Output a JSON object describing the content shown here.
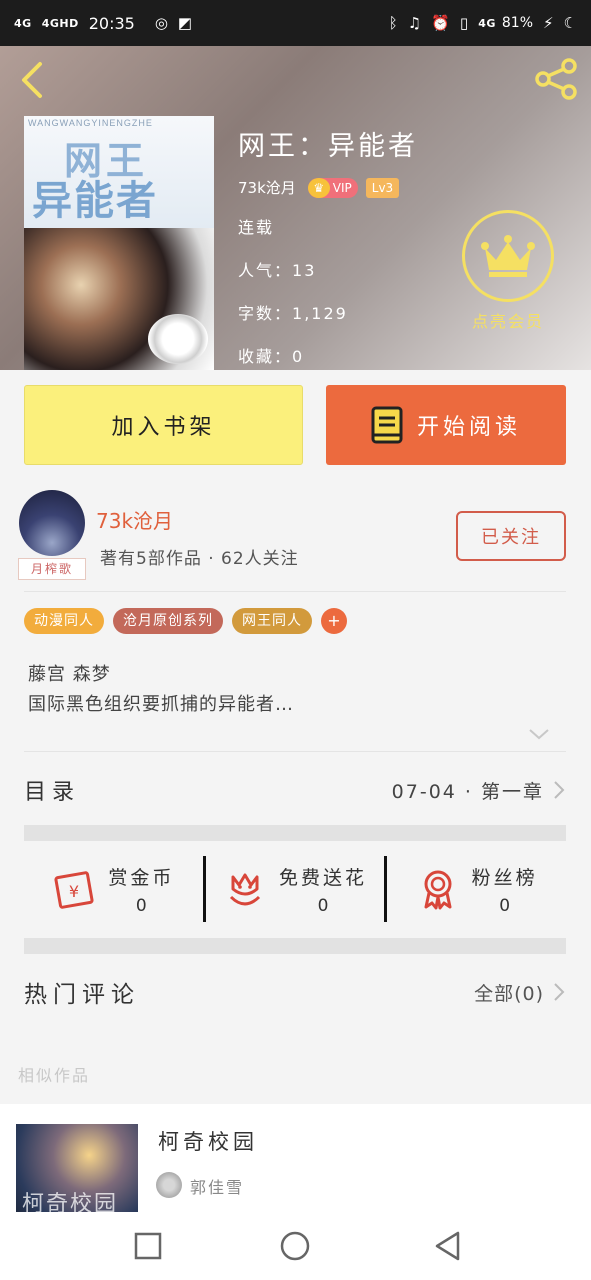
{
  "status_bar": {
    "sig1": "4G",
    "sig2": "4GHD",
    "time": "20:35",
    "net": "4G",
    "battery": "81%"
  },
  "book": {
    "title": "网王：异能者",
    "author": "73k沧月",
    "vip_label": "VIP",
    "level": "Lv3",
    "status": "连载",
    "popularity_label": "人气：",
    "popularity": "13",
    "words_label": "字数：",
    "words": "1,129",
    "favorites_label": "收藏：",
    "favorites": "0",
    "vip_member_label": "点亮会员",
    "cover": {
      "pinyin": "WANGWANGYINENGZHE",
      "line1": "网王",
      "line2": "异能者"
    }
  },
  "actions": {
    "add_shelf": "加入书架",
    "start_reading": "开始阅读"
  },
  "author": {
    "name": "73k沧月",
    "avatar_tag": "月榨歌",
    "meta": "著有5部作品 · 62人关注",
    "follow_state": "已关注"
  },
  "tags": [
    {
      "label": "动漫同人",
      "color": "#f2ac3c"
    },
    {
      "label": "沧月原创系列",
      "color": "#c3695a"
    },
    {
      "label": "网王同人",
      "color": "#d29a3c"
    }
  ],
  "description": {
    "line1": "藤宫 森梦",
    "line2": "国际黑色组织要抓捕的异能者…"
  },
  "toc": {
    "label": "目录",
    "latest": "07-04 · 第一章"
  },
  "rewards": [
    {
      "label": "赏金币",
      "value": "0",
      "icon": "red-envelope-icon"
    },
    {
      "label": "免费送花",
      "value": "0",
      "icon": "flower-icon"
    },
    {
      "label": "粉丝榜",
      "value": "0",
      "icon": "medal-icon"
    }
  ],
  "comments": {
    "label": "热门评论",
    "all": "全部(0)"
  },
  "similar": {
    "section_title": "相似作品",
    "items": [
      {
        "title": "柯奇校园",
        "author": "郭佳雪",
        "cover_text": "柯奇校园"
      }
    ]
  },
  "colors": {
    "accent_orange": "#ec6a3e",
    "shelf_yellow": "#fbf07c",
    "vip_gold": "#f5e062"
  }
}
